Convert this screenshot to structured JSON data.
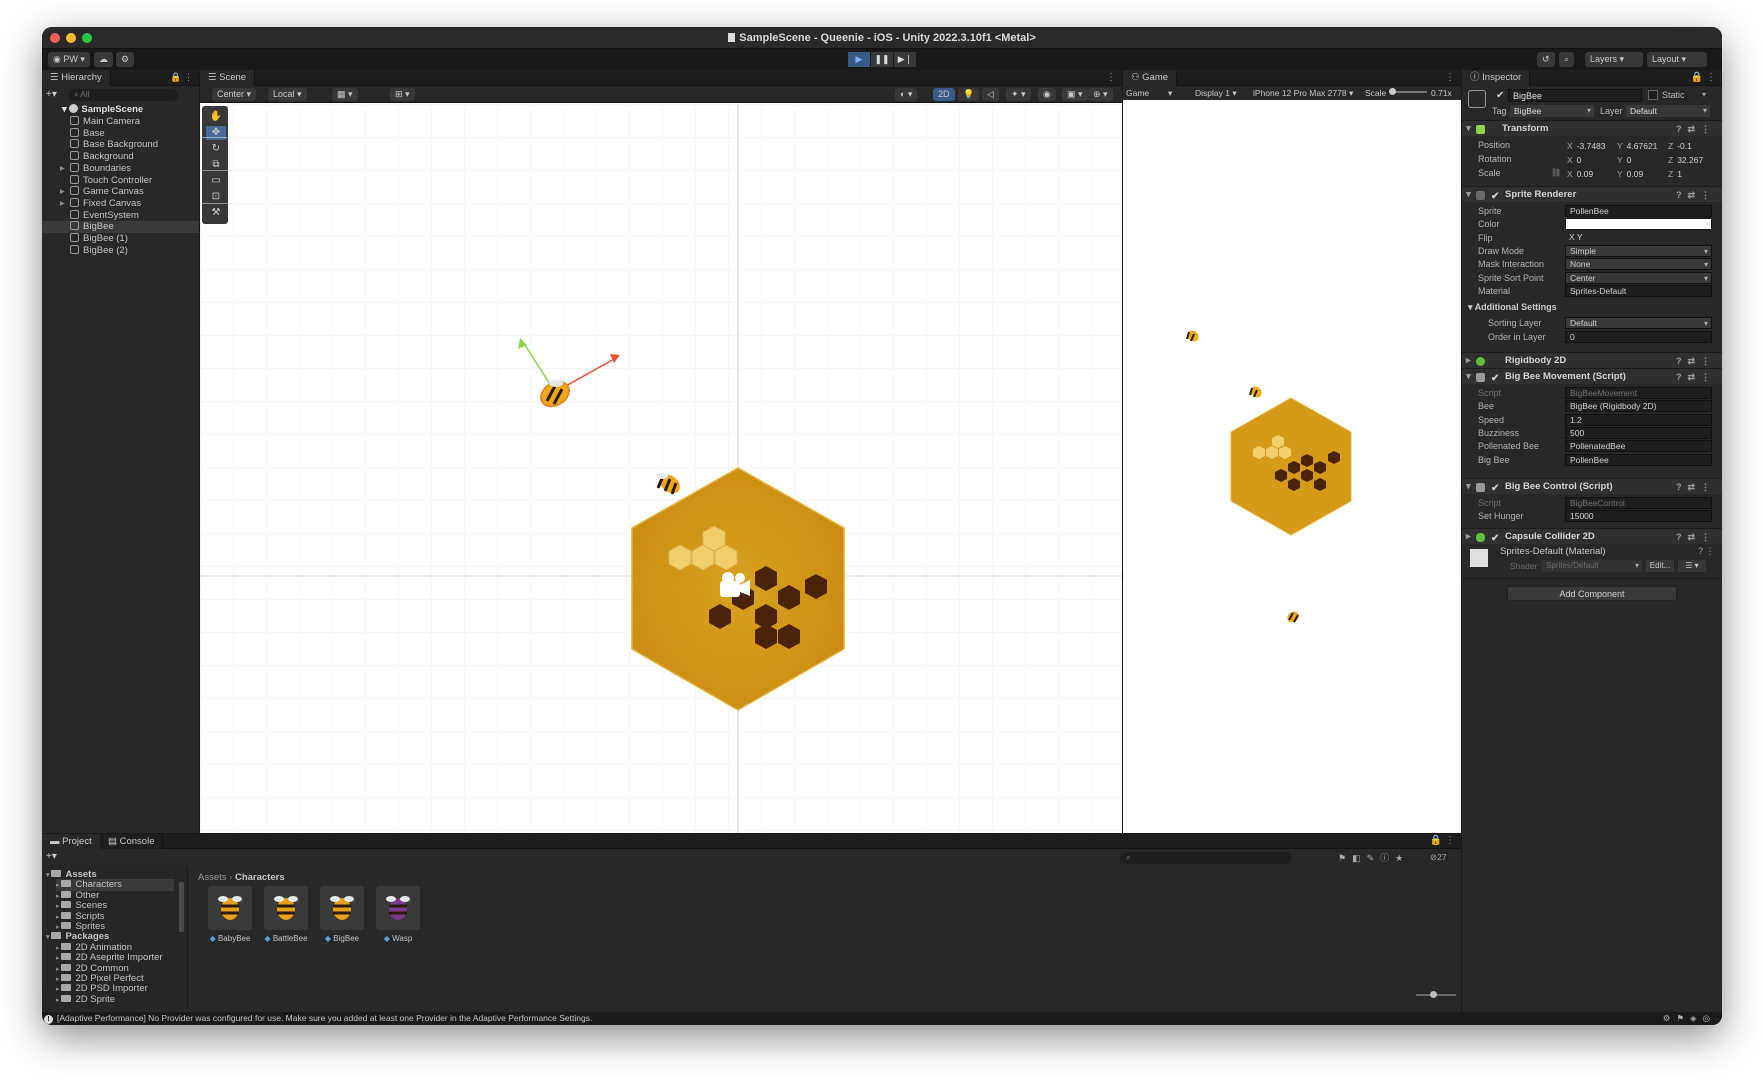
{
  "window": {
    "title": "SampleScene - Queenie - iOS - Unity 2022.3.10f1 <Metal>"
  },
  "toolbar": {
    "account": "PW",
    "layers": "Layers",
    "layout": "Layout"
  },
  "hierarchy": {
    "tab": "Hierarchy",
    "search": "All",
    "scene": "SampleScene",
    "items": [
      "Main Camera",
      "Base",
      "Base Background",
      "Background",
      "Boundaries",
      "Touch Controller",
      "Game Canvas",
      "Fixed Canvas",
      "EventSystem",
      "BigBee",
      "BigBee (1)",
      "BigBee (2)"
    ]
  },
  "scene": {
    "tab": "Scene",
    "pivot": "Center",
    "space": "Local",
    "mode2d": "2D"
  },
  "game": {
    "tab": "Game",
    "mode": "Game",
    "display": "Display 1",
    "device": "iPhone 12 Pro Max",
    "res": "2778",
    "scale_label": "Scale",
    "scale_value": "0.71x"
  },
  "inspector": {
    "tab": "Inspector",
    "object_name": "BigBee",
    "static": "Static",
    "tag_label": "Tag",
    "tag": "BigBee",
    "layer_label": "Layer",
    "layer": "Default",
    "transform": {
      "title": "Transform",
      "position_label": "Position",
      "rotation_label": "Rotation",
      "scale_label": "Scale",
      "pos": [
        "-3.7483",
        "4.67621",
        "-0.1"
      ],
      "rot": [
        "0",
        "0",
        "32.267"
      ],
      "scale": [
        "0.09",
        "0.09",
        "1"
      ]
    },
    "sprite_renderer": {
      "title": "Sprite Renderer",
      "rows": [
        {
          "label": "Sprite",
          "value": "PollenBee"
        },
        {
          "label": "Color",
          "value": ""
        },
        {
          "label": "Flip",
          "value": "X    Y"
        },
        {
          "label": "Draw Mode",
          "value": "Simple"
        },
        {
          "label": "Mask Interaction",
          "value": "None"
        },
        {
          "label": "Sprite Sort Point",
          "value": "Center"
        },
        {
          "label": "Material",
          "value": "Sprites-Default"
        }
      ],
      "additional": "Additional Settings",
      "sorting_label": "Sorting Layer",
      "sorting": "Default",
      "order_label": "Order in Layer",
      "order": "0"
    },
    "rigidbody": {
      "title": "Rigidbody 2D"
    },
    "movement": {
      "title": "Big Bee Movement (Script)",
      "rows": [
        {
          "label": "Script",
          "value": "BigBeeMovement"
        },
        {
          "label": "Bee",
          "value": "BigBee (Rigidbody 2D)"
        },
        {
          "label": "Speed",
          "value": "1.2"
        },
        {
          "label": "Buzziness",
          "value": "500"
        },
        {
          "label": "Pollenated Bee",
          "value": "PollenatedBee"
        },
        {
          "label": "Big Bee",
          "value": "PollenBee"
        }
      ]
    },
    "control": {
      "title": "Big Bee Control (Script)",
      "rows": [
        {
          "label": "Script",
          "value": "BigBeeControl"
        },
        {
          "label": "Set Hunger",
          "value": "15000"
        }
      ]
    },
    "collider": {
      "title": "Capsule Collider 2D"
    },
    "material": {
      "name": "Sprites-Default (Material)",
      "shader_label": "Shader",
      "shader": "Sprites/Default",
      "edit": "Edit..."
    },
    "add_component": "Add Component"
  },
  "project": {
    "tab1": "Project",
    "tab2": "Console",
    "breadcrumb": [
      "Assets",
      "Characters"
    ],
    "badge": "27",
    "tree": [
      {
        "label": "Assets",
        "indent": 0,
        "bold": true
      },
      {
        "label": "Characters",
        "indent": 1,
        "sel": true
      },
      {
        "label": "Other",
        "indent": 1
      },
      {
        "label": "Scenes",
        "indent": 1
      },
      {
        "label": "Scripts",
        "indent": 1
      },
      {
        "label": "Sprites",
        "indent": 1
      },
      {
        "label": "Packages",
        "indent": 0,
        "bold": true
      },
      {
        "label": "2D Animation",
        "indent": 1
      },
      {
        "label": "2D Aseprite Importer",
        "indent": 1
      },
      {
        "label": "2D Common",
        "indent": 1
      },
      {
        "label": "2D Pixel Perfect",
        "indent": 1
      },
      {
        "label": "2D PSD Importer",
        "indent": 1
      },
      {
        "label": "2D Sprite",
        "indent": 1
      }
    ],
    "assets": [
      "BabyBee",
      "BattleBee",
      "BigBee",
      "Wasp"
    ]
  },
  "status": "[Adaptive Performance] No Provider was configured for use. Make sure you added at least one Provider in the Adaptive Performance Settings."
}
